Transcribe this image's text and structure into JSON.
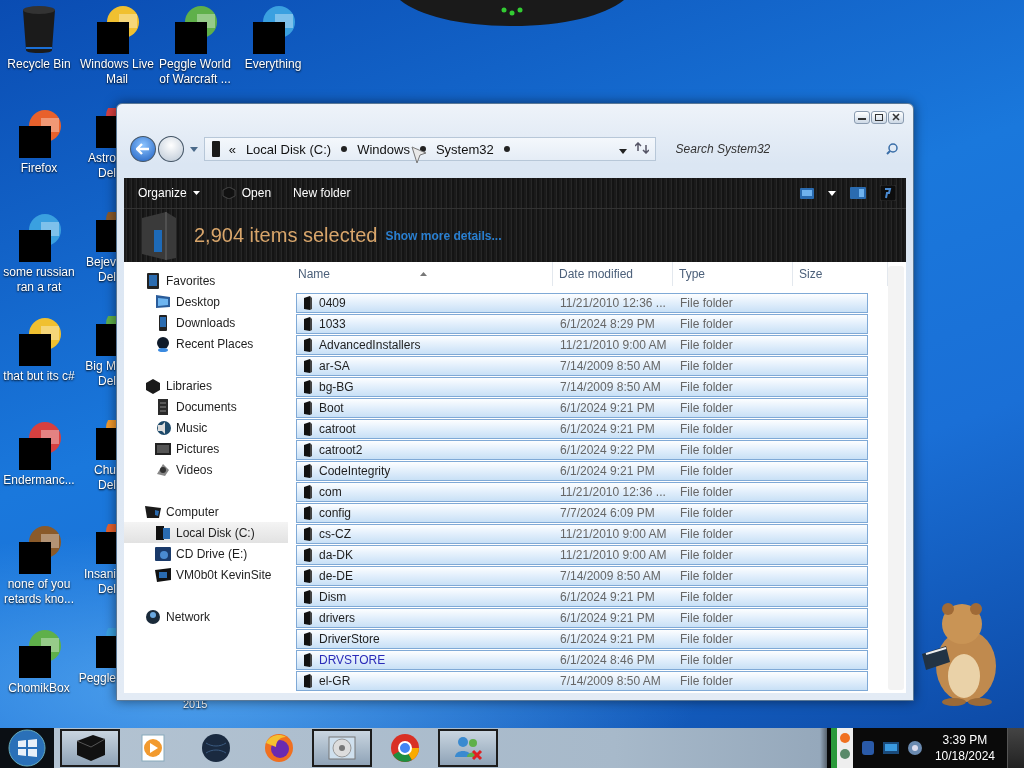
{
  "desktop": {
    "icon_columns": [
      [
        {
          "label": "Recycle Bin"
        },
        {
          "label": "Firefox"
        },
        {
          "label": "some russian\nran a rat"
        },
        {
          "label": "that but its c#"
        },
        {
          "label": "Endermanc..."
        },
        {
          "label": "none of you\nretards kno..."
        },
        {
          "label": "ChomikBox"
        }
      ],
      [
        {
          "label": "Windows Live\nMail"
        },
        {
          "label": "Astro\nDel"
        },
        {
          "label": "Bejev\nDel"
        },
        {
          "label": "Big M\nDel"
        },
        {
          "label": "Chu\nDel"
        },
        {
          "label": "Insani\nDel"
        },
        {
          "label": "Peggle"
        }
      ],
      [
        {
          "label": "Peggle World\nof Warcraft ..."
        }
      ],
      [
        {
          "label": "Everything"
        }
      ]
    ],
    "stray_label": "2015"
  },
  "window": {
    "address": {
      "overflow": "«",
      "crumbs": [
        "Local Disk (C:)",
        "Windows",
        "System32"
      ]
    },
    "search": {
      "placeholder": "Search System32"
    },
    "toolbar": {
      "buttons": [
        {
          "label": "Organize",
          "menu": true
        },
        {
          "label": "Open",
          "menu": false
        },
        {
          "label": "New folder",
          "menu": false
        }
      ]
    },
    "details": {
      "summary": "2,904 items selected",
      "link": "Show more details..."
    },
    "nav_pane": {
      "groups": [
        {
          "label": "Favorites",
          "selected": false,
          "children": [
            {
              "label": "Desktop",
              "selected": false
            },
            {
              "label": "Downloads",
              "selected": false
            },
            {
              "label": "Recent Places",
              "selected": false
            }
          ]
        },
        {
          "label": "Libraries",
          "selected": false,
          "children": [
            {
              "label": "Documents",
              "selected": false
            },
            {
              "label": "Music",
              "selected": false
            },
            {
              "label": "Pictures",
              "selected": false
            },
            {
              "label": "Videos",
              "selected": false
            }
          ]
        },
        {
          "label": "Computer",
          "selected": false,
          "children": [
            {
              "label": "Local Disk (C:)",
              "selected": true
            },
            {
              "label": "CD Drive (E:)",
              "selected": false
            },
            {
              "label": "VM0b0t KevinSite",
              "selected": false
            }
          ]
        },
        {
          "label": "Network",
          "selected": false
        }
      ]
    },
    "file_list": {
      "columns": [
        "Name",
        "Date modified",
        "Type",
        "Size"
      ],
      "rows": [
        {
          "name": "0409",
          "date_modified": "11/21/2010 12:36 ...",
          "type": "File folder",
          "selected": true,
          "compressed": false
        },
        {
          "name": "1033",
          "date_modified": "6/1/2024 8:29 PM",
          "type": "File folder",
          "selected": true,
          "compressed": false
        },
        {
          "name": "AdvancedInstallers",
          "date_modified": "11/21/2010 9:00 AM",
          "type": "File folder",
          "selected": true,
          "compressed": false
        },
        {
          "name": "ar-SA",
          "date_modified": "7/14/2009 8:50 AM",
          "type": "File folder",
          "selected": true,
          "compressed": false
        },
        {
          "name": "bg-BG",
          "date_modified": "7/14/2009 8:50 AM",
          "type": "File folder",
          "selected": true,
          "compressed": false
        },
        {
          "name": "Boot",
          "date_modified": "6/1/2024 9:21 PM",
          "type": "File folder",
          "selected": true,
          "compressed": false
        },
        {
          "name": "catroot",
          "date_modified": "6/1/2024 9:21 PM",
          "type": "File folder",
          "selected": true,
          "compressed": false
        },
        {
          "name": "catroot2",
          "date_modified": "6/1/2024 9:22 PM",
          "type": "File folder",
          "selected": true,
          "compressed": false
        },
        {
          "name": "CodeIntegrity",
          "date_modified": "6/1/2024 9:21 PM",
          "type": "File folder",
          "selected": true,
          "compressed": false
        },
        {
          "name": "com",
          "date_modified": "11/21/2010 12:36 ...",
          "type": "File folder",
          "selected": true,
          "compressed": false
        },
        {
          "name": "config",
          "date_modified": "7/7/2024 6:09 PM",
          "type": "File folder",
          "selected": true,
          "compressed": false
        },
        {
          "name": "cs-CZ",
          "date_modified": "11/21/2010 9:00 AM",
          "type": "File folder",
          "selected": true,
          "compressed": false
        },
        {
          "name": "da-DK",
          "date_modified": "11/21/2010 9:00 AM",
          "type": "File folder",
          "selected": true,
          "compressed": false
        },
        {
          "name": "de-DE",
          "date_modified": "7/14/2009 8:50 AM",
          "type": "File folder",
          "selected": true,
          "compressed": false
        },
        {
          "name": "Dism",
          "date_modified": "6/1/2024 9:21 PM",
          "type": "File folder",
          "selected": true,
          "compressed": false
        },
        {
          "name": "drivers",
          "date_modified": "6/1/2024 9:21 PM",
          "type": "File folder",
          "selected": true,
          "compressed": false
        },
        {
          "name": "DriverStore",
          "date_modified": "6/1/2024 9:21 PM",
          "type": "File folder",
          "selected": true,
          "compressed": false
        },
        {
          "name": "DRVSTORE",
          "date_modified": "6/1/2024 8:46 PM",
          "type": "File folder",
          "selected": true,
          "compressed": true
        },
        {
          "name": "el-GR",
          "date_modified": "7/14/2009 8:50 AM",
          "type": "File folder",
          "selected": true,
          "compressed": false
        }
      ]
    }
  },
  "taskbar": {
    "items": [
      {
        "running": true
      },
      {
        "running": false
      },
      {
        "running": false
      },
      {
        "running": false
      },
      {
        "running": true
      },
      {
        "running": false
      },
      {
        "running": true
      }
    ],
    "clock": {
      "time": "3:39 PM",
      "date": "10/18/2024"
    }
  }
}
